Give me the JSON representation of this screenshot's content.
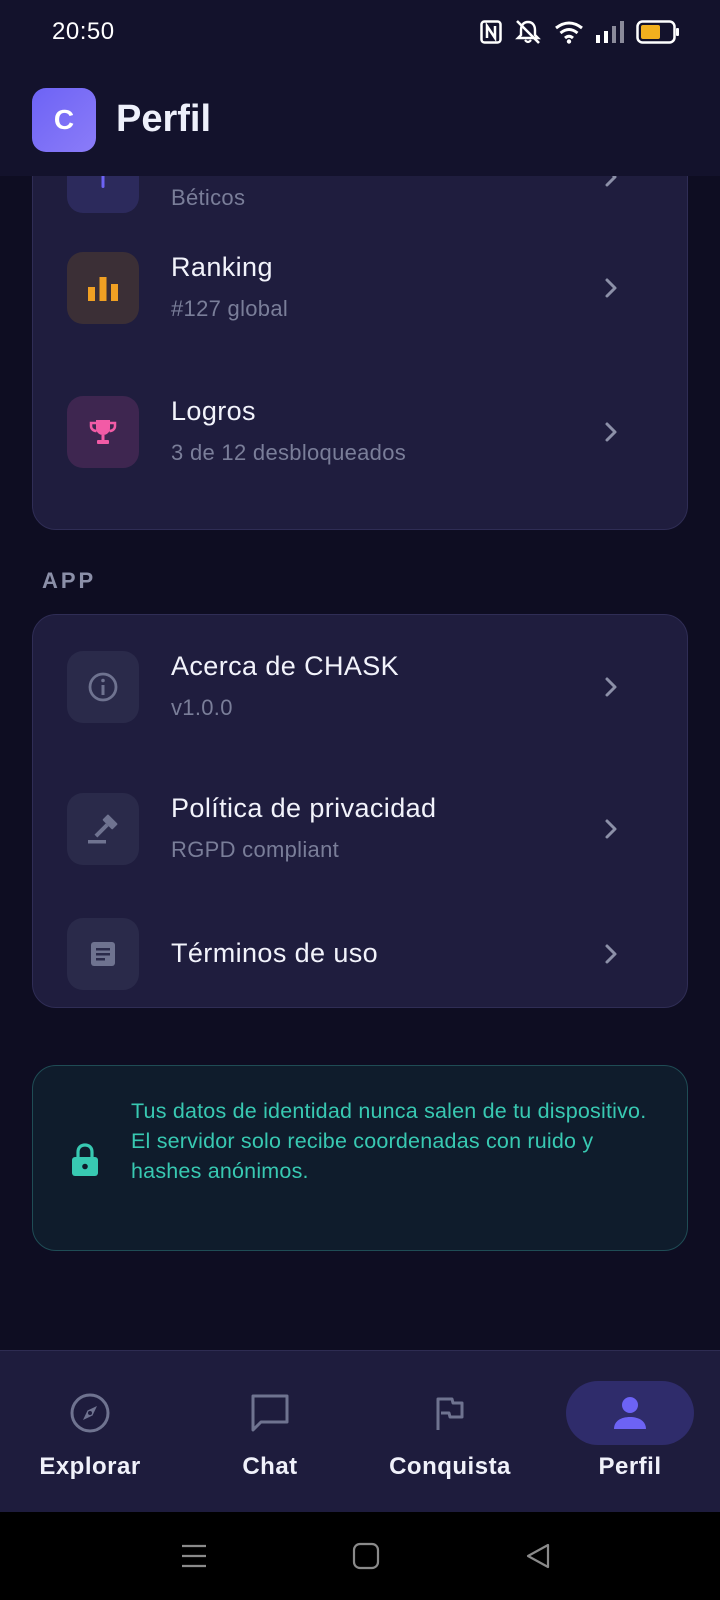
{
  "status_bar": {
    "time": "20:50"
  },
  "header": {
    "logo_letter": "C",
    "title": "Perfil"
  },
  "stats_card": {
    "rows": [
      {
        "title": "",
        "subtitle": "Béticos",
        "icon": "team-icon"
      },
      {
        "title": "Ranking",
        "subtitle": "#127 global",
        "icon": "bar-chart-icon"
      },
      {
        "title": "Logros",
        "subtitle": "3 de 12 desbloqueados",
        "icon": "trophy-icon"
      }
    ]
  },
  "app_section": {
    "label": "APP",
    "rows": [
      {
        "title": "Acerca de CHASK",
        "subtitle": "v1.0.0",
        "icon": "info-icon"
      },
      {
        "title": "Política de privacidad",
        "subtitle": "RGPD compliant",
        "icon": "gavel-icon"
      },
      {
        "title": "Términos de uso",
        "subtitle": "",
        "icon": "document-icon"
      }
    ]
  },
  "privacy_notice": {
    "line1": "Tus datos de identidad nunca salen de tu dispositivo.",
    "line2": "El servidor solo recibe coordenadas con ruido y hashes anónimos."
  },
  "bottom_nav": {
    "items": [
      {
        "label": "Explorar",
        "icon": "compass-icon",
        "active": false
      },
      {
        "label": "Chat",
        "icon": "chat-icon",
        "active": false
      },
      {
        "label": "Conquista",
        "icon": "flag-icon",
        "active": false
      },
      {
        "label": "Perfil",
        "icon": "person-icon",
        "active": true
      }
    ]
  },
  "colors": {
    "background": "#0e0d22",
    "card": "#1f1d3e",
    "accent": "#6d63f5",
    "ranking": "#f0a023",
    "trophy": "#f25ba6",
    "notice_text": "#38c9b2"
  }
}
